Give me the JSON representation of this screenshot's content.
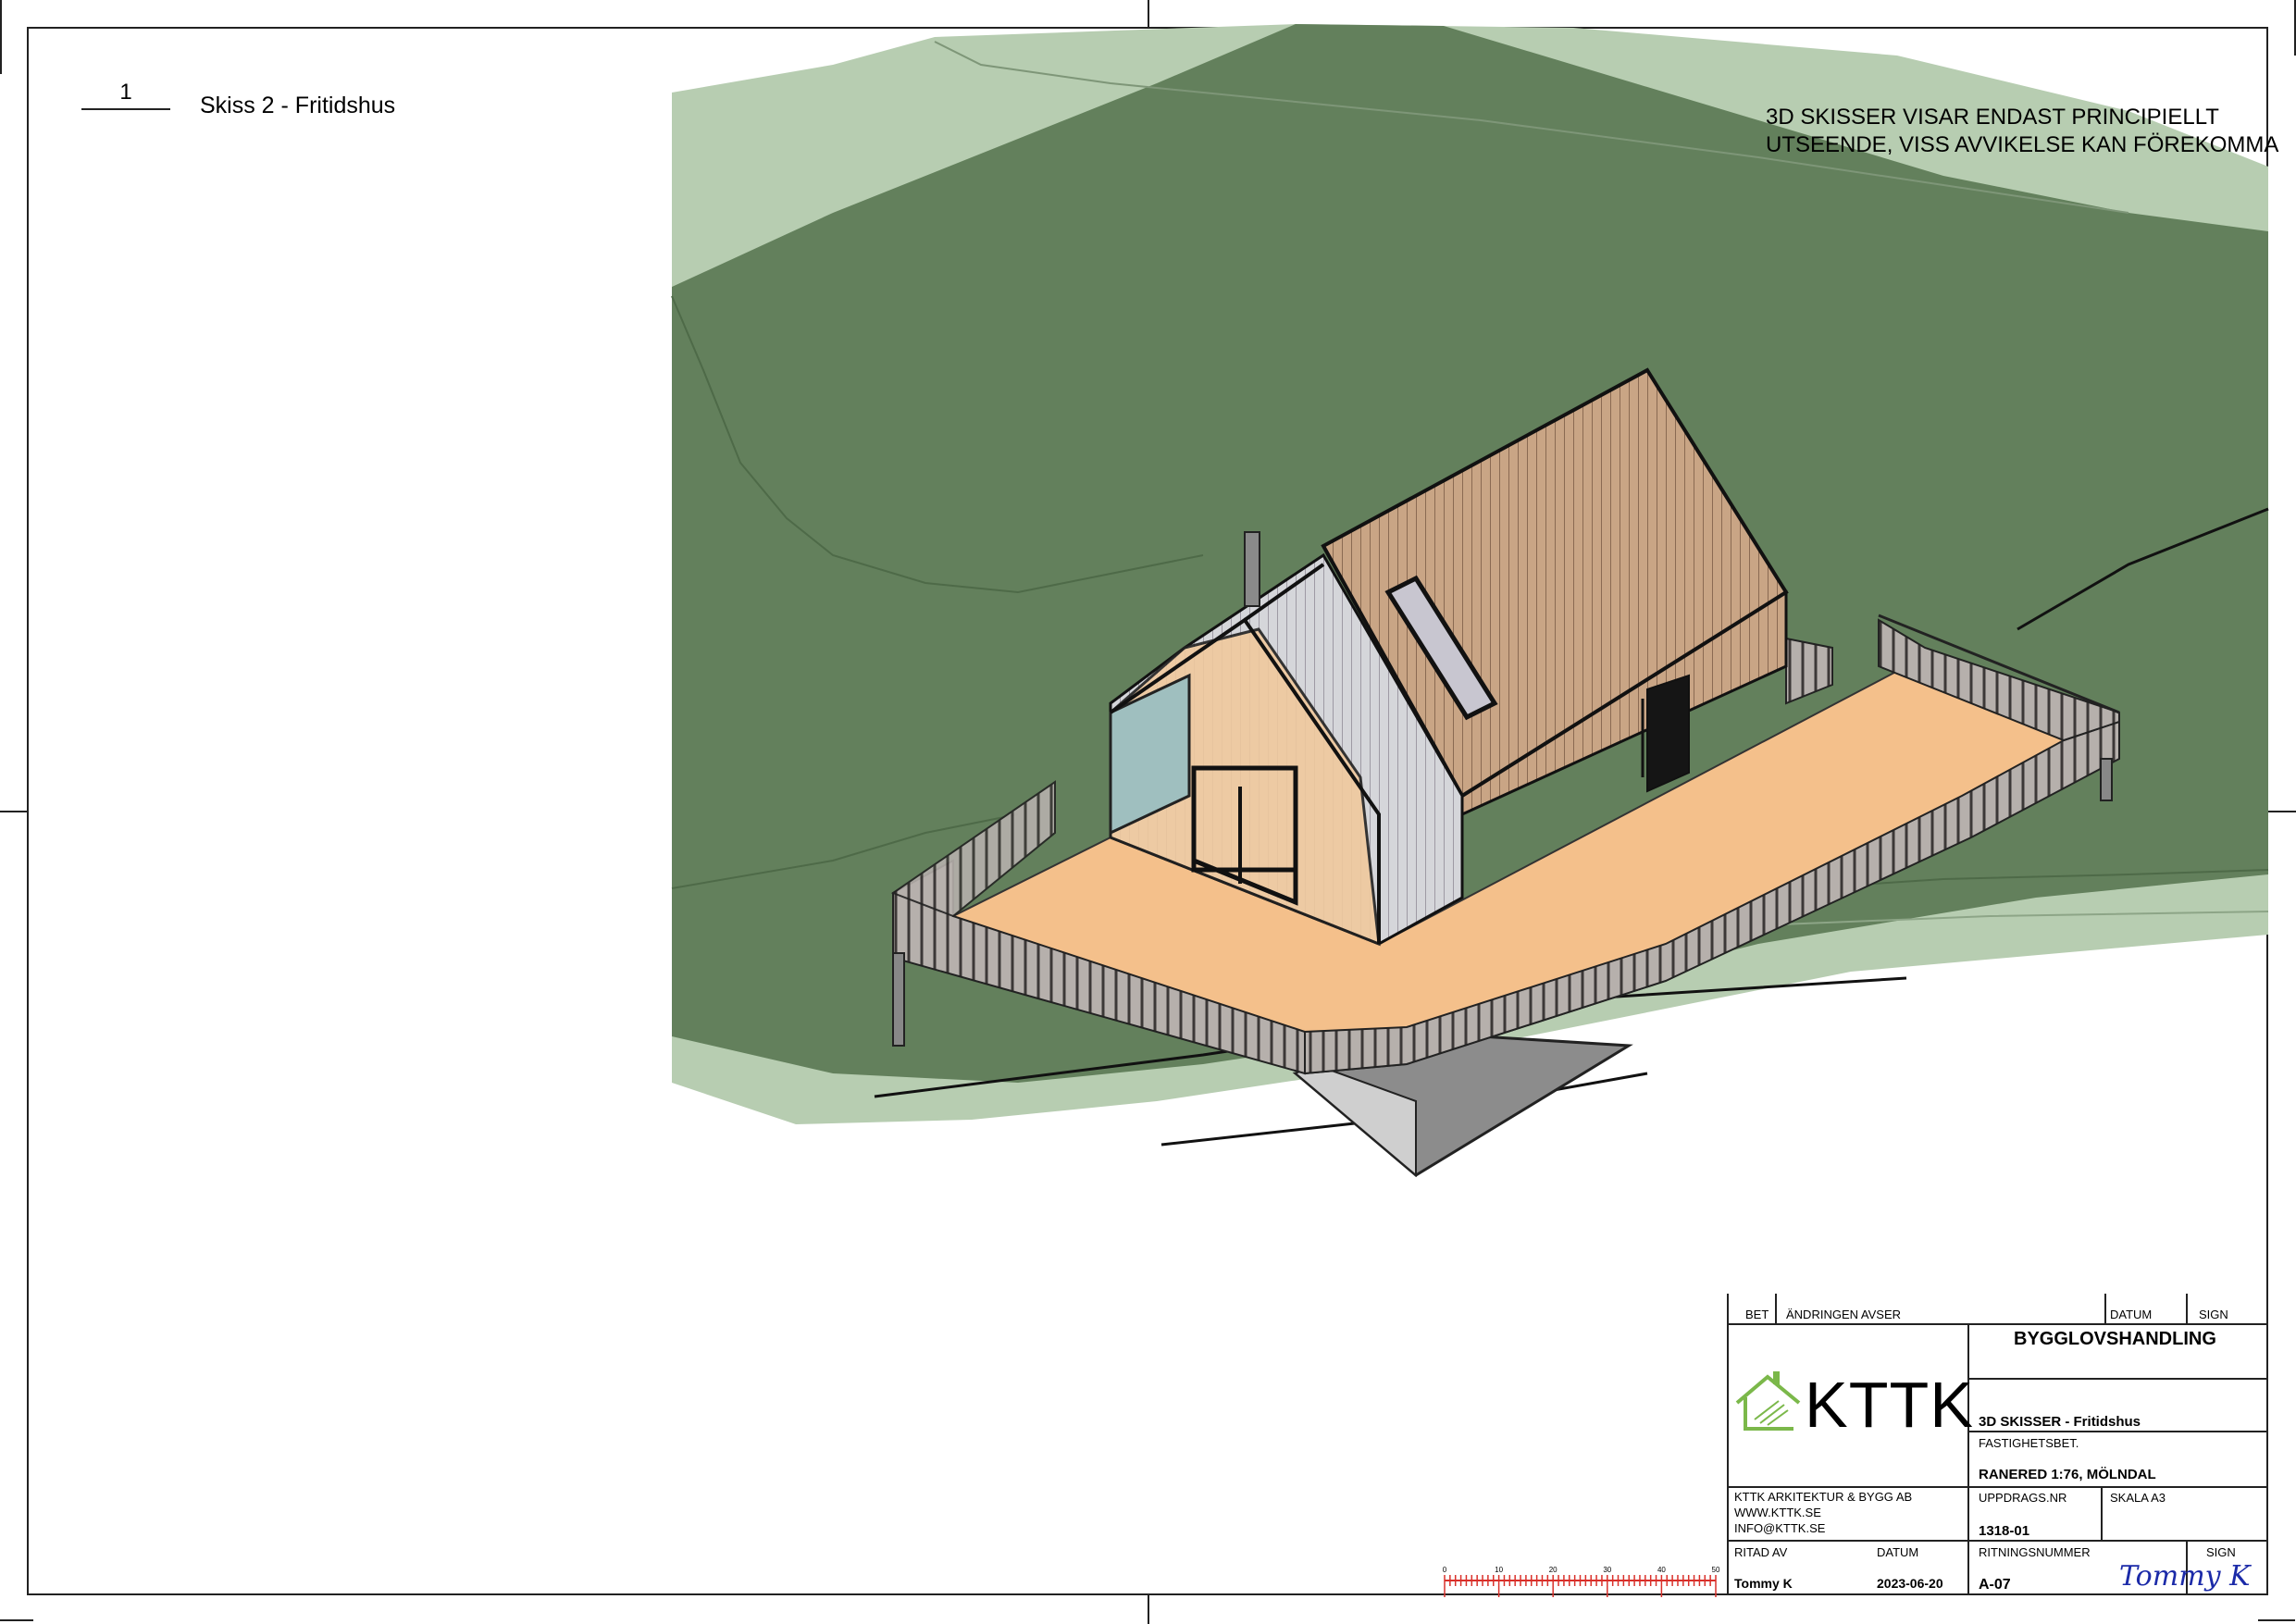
{
  "view": {
    "number": "1",
    "title": "Skiss 2 - Fritidshus"
  },
  "disclaimer": {
    "line1": "3D SKISSER VISAR ENDAST PRINCIPIELLT",
    "line2": "UTSEENDE, VISS AVVIKELSE KAN FÖREKOMMA"
  },
  "title_block": {
    "revision_headers": {
      "bet": "BET",
      "andringen_avser": "ÄNDRINGEN AVSER",
      "datum": "DATUM",
      "sign": "SIGN"
    },
    "stage": "BYGGLOVSHANDLING",
    "logo": {
      "text": "KTTK",
      "icon": "house-logo-icon"
    },
    "company": {
      "name": "KTTK ARKITEKTUR & BYGG AB",
      "web": "WWW.KTTK.SE",
      "email": "INFO@KTTK.SE"
    },
    "drawing_title": "3D SKISSER - Fritidshus",
    "property_label": "FASTIGHETSBET.",
    "property_value": "RANERED 1:76, MÖLNDAL",
    "project_number_label": "UPPDRAGS.NR",
    "project_number": "1318-01",
    "scale_label": "SKALA A3",
    "drawn_by_label": "RITAD AV",
    "drawn_by": "Tommy K",
    "date_label": "DATUM",
    "date": "2023-06-20",
    "drawing_number_label": "RITNINGSNUMMER",
    "drawing_number": "A-07",
    "sign_label": "SIGN",
    "signature": "Tommy K"
  },
  "scale_bar": {
    "ticks": [
      "0",
      "10",
      "20",
      "30",
      "40",
      "50"
    ]
  },
  "colors": {
    "terrain_dark": "#63805c",
    "terrain_light": "#b7cdb1",
    "deck": "#f4c08b",
    "cladding": "#c9a585",
    "glass": "#b9c8cf",
    "scale_red": "#d9302a",
    "logo_green": "#7bb84a",
    "signature_blue": "#1b2aa8"
  }
}
